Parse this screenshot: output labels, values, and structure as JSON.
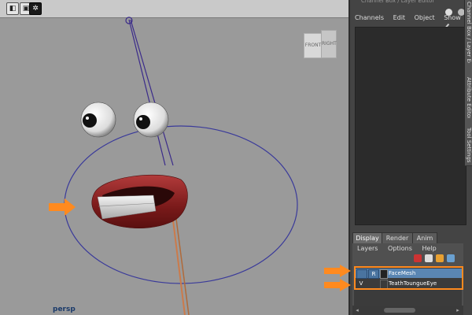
{
  "viewport": {
    "camera_label": "persp",
    "viewcube": {
      "front": "FRONT",
      "right": "RIGHT"
    }
  },
  "right_panel": {
    "header_title": "Channel Box / Layer Editor",
    "menu": [
      "Channels",
      "Edit",
      "Object",
      "Show"
    ],
    "side_tabs": [
      "Channel Box / Layer Editor",
      "Attribute Editor",
      "Tool Settings"
    ]
  },
  "layer_editor": {
    "tabs": [
      "Display",
      "Render",
      "Anim"
    ],
    "active_tab": "Display",
    "menu": [
      "Layers",
      "Options",
      "Help"
    ],
    "layers": [
      {
        "visible": "",
        "ref": "R",
        "name": "FaceMesh",
        "selected": true
      },
      {
        "visible": "V",
        "ref": "",
        "name": "TeathToungueEye",
        "selected": false
      }
    ]
  },
  "colors": {
    "highlight": "#ff8a1f",
    "selected_row": "#5a86b3",
    "viewport_bg": "#9a9a9a"
  }
}
